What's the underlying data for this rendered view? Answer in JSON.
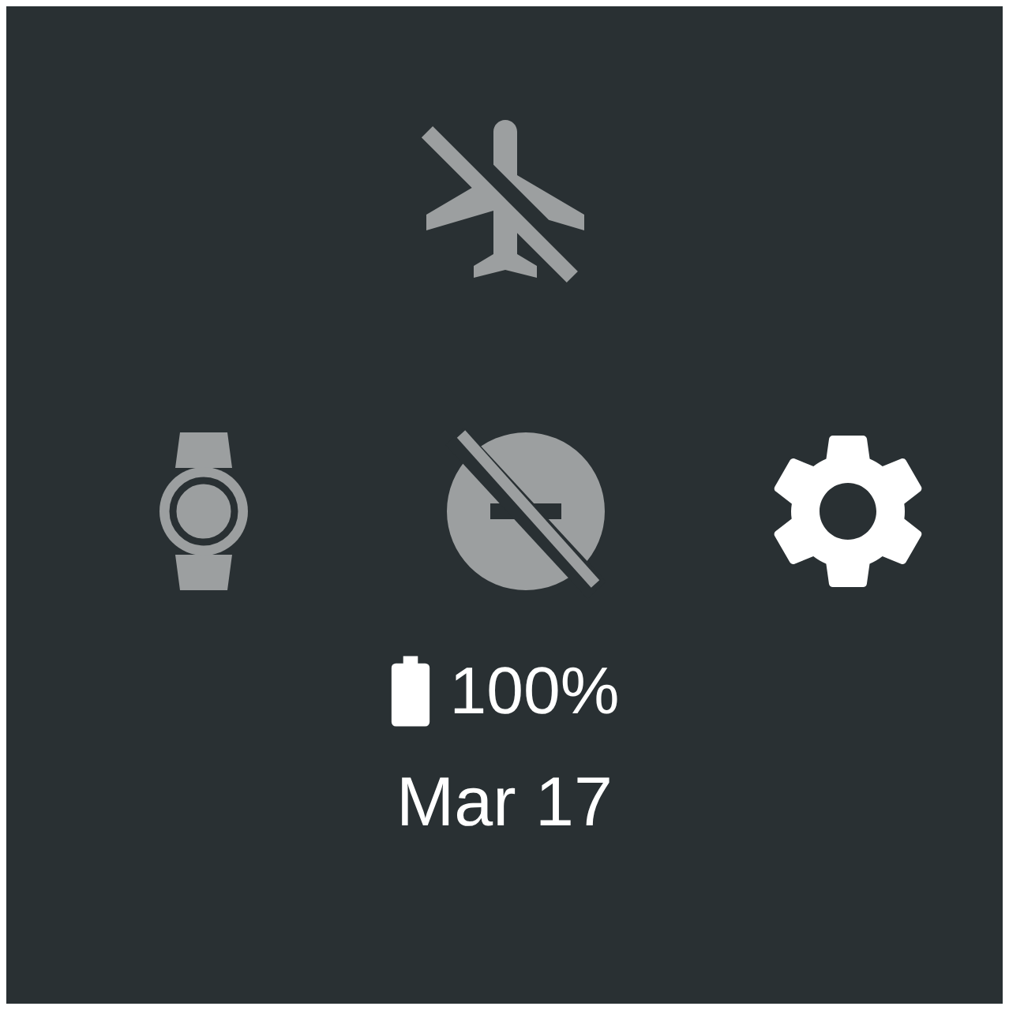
{
  "top_tiles": [
    {
      "on": false
    }
  ],
  "row_tiles": [
    {
      "kind": "toggle",
      "on": false
    },
    {
      "kind": "toggle",
      "on": false
    },
    {
      "kind": "action"
    }
  ],
  "battery": {
    "text": "100%"
  },
  "date": "Mar 17"
}
